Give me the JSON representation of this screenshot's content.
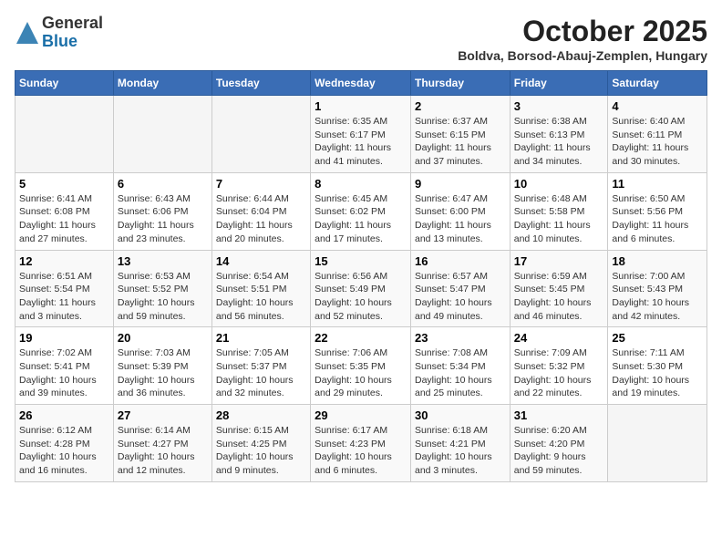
{
  "logo": {
    "general": "General",
    "blue": "Blue"
  },
  "title": "October 2025",
  "location": "Boldva, Borsod-Abauj-Zemplen, Hungary",
  "headers": [
    "Sunday",
    "Monday",
    "Tuesday",
    "Wednesday",
    "Thursday",
    "Friday",
    "Saturday"
  ],
  "weeks": [
    [
      {
        "day": "",
        "info": ""
      },
      {
        "day": "",
        "info": ""
      },
      {
        "day": "",
        "info": ""
      },
      {
        "day": "1",
        "info": "Sunrise: 6:35 AM\nSunset: 6:17 PM\nDaylight: 11 hours and 41 minutes."
      },
      {
        "day": "2",
        "info": "Sunrise: 6:37 AM\nSunset: 6:15 PM\nDaylight: 11 hours and 37 minutes."
      },
      {
        "day": "3",
        "info": "Sunrise: 6:38 AM\nSunset: 6:13 PM\nDaylight: 11 hours and 34 minutes."
      },
      {
        "day": "4",
        "info": "Sunrise: 6:40 AM\nSunset: 6:11 PM\nDaylight: 11 hours and 30 minutes."
      }
    ],
    [
      {
        "day": "5",
        "info": "Sunrise: 6:41 AM\nSunset: 6:08 PM\nDaylight: 11 hours and 27 minutes."
      },
      {
        "day": "6",
        "info": "Sunrise: 6:43 AM\nSunset: 6:06 PM\nDaylight: 11 hours and 23 minutes."
      },
      {
        "day": "7",
        "info": "Sunrise: 6:44 AM\nSunset: 6:04 PM\nDaylight: 11 hours and 20 minutes."
      },
      {
        "day": "8",
        "info": "Sunrise: 6:45 AM\nSunset: 6:02 PM\nDaylight: 11 hours and 17 minutes."
      },
      {
        "day": "9",
        "info": "Sunrise: 6:47 AM\nSunset: 6:00 PM\nDaylight: 11 hours and 13 minutes."
      },
      {
        "day": "10",
        "info": "Sunrise: 6:48 AM\nSunset: 5:58 PM\nDaylight: 11 hours and 10 minutes."
      },
      {
        "day": "11",
        "info": "Sunrise: 6:50 AM\nSunset: 5:56 PM\nDaylight: 11 hours and 6 minutes."
      }
    ],
    [
      {
        "day": "12",
        "info": "Sunrise: 6:51 AM\nSunset: 5:54 PM\nDaylight: 11 hours and 3 minutes."
      },
      {
        "day": "13",
        "info": "Sunrise: 6:53 AM\nSunset: 5:52 PM\nDaylight: 10 hours and 59 minutes."
      },
      {
        "day": "14",
        "info": "Sunrise: 6:54 AM\nSunset: 5:51 PM\nDaylight: 10 hours and 56 minutes."
      },
      {
        "day": "15",
        "info": "Sunrise: 6:56 AM\nSunset: 5:49 PM\nDaylight: 10 hours and 52 minutes."
      },
      {
        "day": "16",
        "info": "Sunrise: 6:57 AM\nSunset: 5:47 PM\nDaylight: 10 hours and 49 minutes."
      },
      {
        "day": "17",
        "info": "Sunrise: 6:59 AM\nSunset: 5:45 PM\nDaylight: 10 hours and 46 minutes."
      },
      {
        "day": "18",
        "info": "Sunrise: 7:00 AM\nSunset: 5:43 PM\nDaylight: 10 hours and 42 minutes."
      }
    ],
    [
      {
        "day": "19",
        "info": "Sunrise: 7:02 AM\nSunset: 5:41 PM\nDaylight: 10 hours and 39 minutes."
      },
      {
        "day": "20",
        "info": "Sunrise: 7:03 AM\nSunset: 5:39 PM\nDaylight: 10 hours and 36 minutes."
      },
      {
        "day": "21",
        "info": "Sunrise: 7:05 AM\nSunset: 5:37 PM\nDaylight: 10 hours and 32 minutes."
      },
      {
        "day": "22",
        "info": "Sunrise: 7:06 AM\nSunset: 5:35 PM\nDaylight: 10 hours and 29 minutes."
      },
      {
        "day": "23",
        "info": "Sunrise: 7:08 AM\nSunset: 5:34 PM\nDaylight: 10 hours and 25 minutes."
      },
      {
        "day": "24",
        "info": "Sunrise: 7:09 AM\nSunset: 5:32 PM\nDaylight: 10 hours and 22 minutes."
      },
      {
        "day": "25",
        "info": "Sunrise: 7:11 AM\nSunset: 5:30 PM\nDaylight: 10 hours and 19 minutes."
      }
    ],
    [
      {
        "day": "26",
        "info": "Sunrise: 6:12 AM\nSunset: 4:28 PM\nDaylight: 10 hours and 16 minutes."
      },
      {
        "day": "27",
        "info": "Sunrise: 6:14 AM\nSunset: 4:27 PM\nDaylight: 10 hours and 12 minutes."
      },
      {
        "day": "28",
        "info": "Sunrise: 6:15 AM\nSunset: 4:25 PM\nDaylight: 10 hours and 9 minutes."
      },
      {
        "day": "29",
        "info": "Sunrise: 6:17 AM\nSunset: 4:23 PM\nDaylight: 10 hours and 6 minutes."
      },
      {
        "day": "30",
        "info": "Sunrise: 6:18 AM\nSunset: 4:21 PM\nDaylight: 10 hours and 3 minutes."
      },
      {
        "day": "31",
        "info": "Sunrise: 6:20 AM\nSunset: 4:20 PM\nDaylight: 9 hours and 59 minutes."
      },
      {
        "day": "",
        "info": ""
      }
    ]
  ]
}
